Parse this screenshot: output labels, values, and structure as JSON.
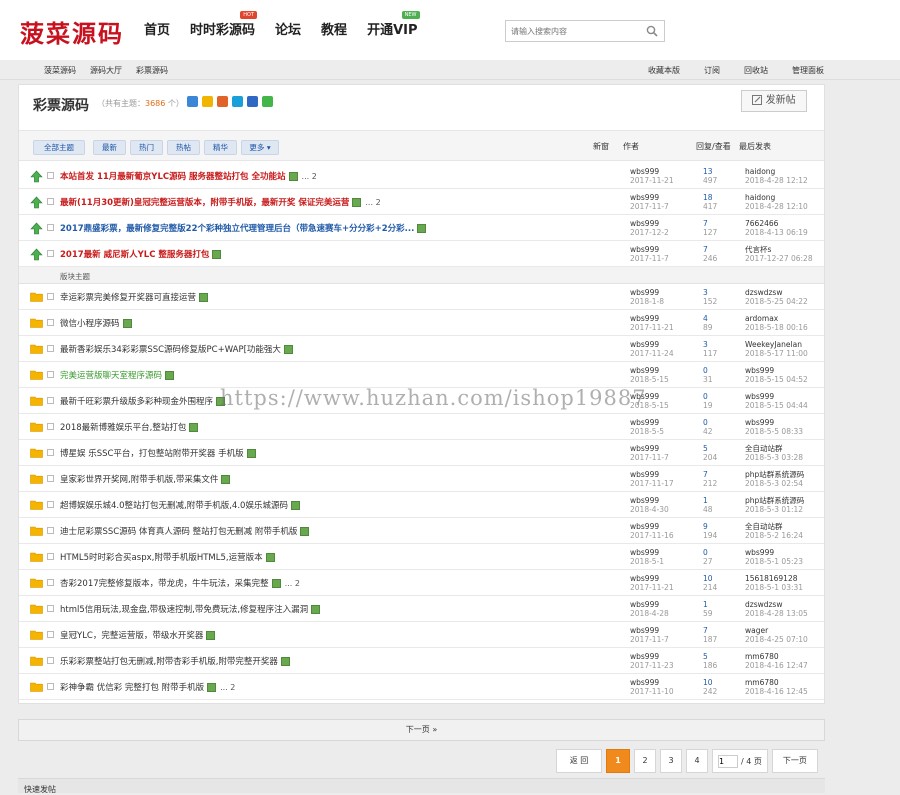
{
  "logo": "菠菜源码",
  "nav": [
    {
      "label": "首页",
      "badge": ""
    },
    {
      "label": "时时彩源码",
      "badge": "HOT"
    },
    {
      "label": "论坛",
      "badge": ""
    },
    {
      "label": "教程",
      "badge": ""
    },
    {
      "label": "开通VIP",
      "badge": "NEW"
    }
  ],
  "search": {
    "placeholder": "请输入搜索内容"
  },
  "breadcrumb": [
    "菠菜源码",
    "源码大厅",
    "彩票源码"
  ],
  "toplinks": [
    "收藏本版",
    "订阅",
    "回收站",
    "管理面板"
  ],
  "forum": {
    "title": "彩票源码",
    "count_prefix": "（共有主题：",
    "count": "3686",
    "count_suffix": " 个）"
  },
  "post_button": "发新帖",
  "filters": [
    "全部主题",
    "最新",
    "热门",
    "热帖",
    "精华",
    "更多"
  ],
  "columns": {
    "new": "新窗",
    "author": "作者",
    "reply": "回复/查看",
    "last": "最后发表"
  },
  "section_label": "版块主题",
  "sticky": [
    {
      "title": "本站首发 11月最新葡京YLC源码 服务器整站打包 全功能站",
      "style": "red",
      "pages": "... 2",
      "author": "wbs999",
      "date": "2017-11-21",
      "replies": "13",
      "views": "497",
      "last_user": "haidong",
      "last_time": "2018-4-28 12:12"
    },
    {
      "title": "最新(11月30更新)皇冠完整运营版本，附带手机版，最新开奖 保证完美运营",
      "style": "red",
      "pages": "... 2",
      "author": "wbs999",
      "date": "2017-11-7",
      "replies": "18",
      "views": "417",
      "last_user": "haidong",
      "last_time": "2018-4-28 12:10"
    },
    {
      "title": "2017鼎盛彩票，最新修复完整版22个彩种独立代理管理后台（带急速赛车+分分彩+2分彩...",
      "style": "blue",
      "pages": "",
      "author": "wbs999",
      "date": "2017-12-2",
      "replies": "7",
      "views": "127",
      "last_user": "7662466",
      "last_time": "2018-4-13 06:19"
    },
    {
      "title": "2017最新 威尼斯人YLC 整服务器打包",
      "style": "red",
      "pages": "",
      "author": "wbs999",
      "date": "2017-11-7",
      "replies": "7",
      "views": "246",
      "last_user": "代言杯s",
      "last_time": "2017-12-27 06:28"
    }
  ],
  "threads": [
    {
      "title": "幸运彩票完美修复开奖器可直接运营",
      "style": "",
      "pages": "",
      "author": "wbs999",
      "date": "2018-1-8",
      "replies": "3",
      "views": "152",
      "last_user": "dzswdzsw",
      "last_time": "2018-5-25 04:22"
    },
    {
      "title": "微信小程序源码",
      "style": "",
      "pages": "",
      "author": "wbs999",
      "date": "2017-11-21",
      "replies": "4",
      "views": "89",
      "last_user": "ardomax",
      "last_time": "2018-5-18 00:16"
    },
    {
      "title": "最新香彩娱乐34彩彩票SSC源码修复版PC+WAP[功能强大",
      "style": "",
      "pages": "",
      "author": "wbs999",
      "date": "2017-11-24",
      "replies": "3",
      "views": "117",
      "last_user": "WeekeyJanelan",
      "last_time": "2018-5-17 11:00"
    },
    {
      "title": "完美运营版聊天室程序源码",
      "style": "green",
      "pages": "",
      "author": "wbs999",
      "date": "2018-5-15",
      "replies": "0",
      "views": "31",
      "last_user": "wbs999",
      "last_time": "2018-5-15 04:52"
    },
    {
      "title": "最新千旺彩票升级版多彩种现金外围程序",
      "style": "",
      "pages": "",
      "author": "wbs999",
      "date": "2018-5-15",
      "replies": "0",
      "views": "19",
      "last_user": "wbs999",
      "last_time": "2018-5-15 04:44"
    },
    {
      "title": "2018最新博雅娱乐平台,整站打包",
      "style": "",
      "pages": "",
      "author": "wbs999",
      "date": "2018-5-5",
      "replies": "0",
      "views": "42",
      "last_user": "wbs999",
      "last_time": "2018-5-5 08:33"
    },
    {
      "title": "博星娱 乐SSC平台，打包整站附带开奖器 手机版",
      "style": "",
      "pages": "",
      "author": "wbs999",
      "date": "2017-11-7",
      "replies": "5",
      "views": "204",
      "last_user": "全自动站群",
      "last_time": "2018-5-3 03:28"
    },
    {
      "title": "皇家彩世界开奖网,附带手机版,带采集文件",
      "style": "",
      "pages": "",
      "author": "wbs999",
      "date": "2017-11-17",
      "replies": "7",
      "views": "212",
      "last_user": "php站群系统源码",
      "last_time": "2018-5-3 02:54"
    },
    {
      "title": "超博娱娱乐城4.0整站打包无删减,附带手机版,4.0娱乐城源码",
      "style": "",
      "pages": "",
      "author": "wbs999",
      "date": "2018-4-30",
      "replies": "1",
      "views": "48",
      "last_user": "php站群系统源码",
      "last_time": "2018-5-3 01:12"
    },
    {
      "title": "迪士尼彩票SSC源码 体育真人源码 整站打包无删减 附带手机版",
      "style": "",
      "pages": "",
      "author": "wbs999",
      "date": "2017-11-16",
      "replies": "9",
      "views": "194",
      "last_user": "全自动站群",
      "last_time": "2018-5-2 16:24"
    },
    {
      "title": "HTML5时时彩合买aspx,附带手机版HTML5,运营版本",
      "style": "",
      "pages": "",
      "author": "wbs999",
      "date": "2018-5-1",
      "replies": "0",
      "views": "27",
      "last_user": "wbs999",
      "last_time": "2018-5-1 05:23"
    },
    {
      "title": "杏彩2017完整修复版本，带龙虎，牛牛玩法，采集完整",
      "style": "",
      "pages": "... 2",
      "author": "wbs999",
      "date": "2017-11-21",
      "replies": "10",
      "views": "214",
      "last_user": "15618169128",
      "last_time": "2018-5-1 03:31"
    },
    {
      "title": "html5信用玩法,现金盘,带极速控制,带免费玩法,修复程序注入漏洞",
      "style": "",
      "pages": "",
      "author": "wbs999",
      "date": "2018-4-28",
      "replies": "1",
      "views": "59",
      "last_user": "dzswdzsw",
      "last_time": "2018-4-28 13:05"
    },
    {
      "title": "皇冠YLC，完整运营版，带级水开奖器",
      "style": "",
      "pages": "",
      "author": "wbs999",
      "date": "2017-11-7",
      "replies": "7",
      "views": "187",
      "last_user": "wager",
      "last_time": "2018-4-25 07:10"
    },
    {
      "title": "乐彩彩票整站打包无删减,附带杏彩手机版,附带完整开奖器",
      "style": "",
      "pages": "",
      "author": "wbs999",
      "date": "2017-11-23",
      "replies": "5",
      "views": "186",
      "last_user": "mm6780",
      "last_time": "2018-4-16 12:47"
    },
    {
      "title": "彩神争霸 优信彩 完整打包 附带手机版",
      "style": "",
      "pages": "... 2",
      "author": "wbs999",
      "date": "2017-11-10",
      "replies": "10",
      "views": "242",
      "last_user": "mm6780",
      "last_time": "2018-4-16 12:45"
    }
  ],
  "next_page": "下一页 »",
  "pager": {
    "back": "返 回",
    "pages": [
      "1",
      "2",
      "3",
      "4"
    ],
    "current": "1",
    "input_value": "1",
    "total": "/ 4 页",
    "next": "下一页"
  },
  "quick_post": "快速发帖",
  "watermark": "https://www.huzhan.com/ishop19887",
  "colors": {
    "logo": "#c8111e",
    "title_red": "#c81b1b",
    "title_blue": "#215ba8",
    "link_blue": "#1c54a3",
    "pager_current": "#f08a1c"
  }
}
